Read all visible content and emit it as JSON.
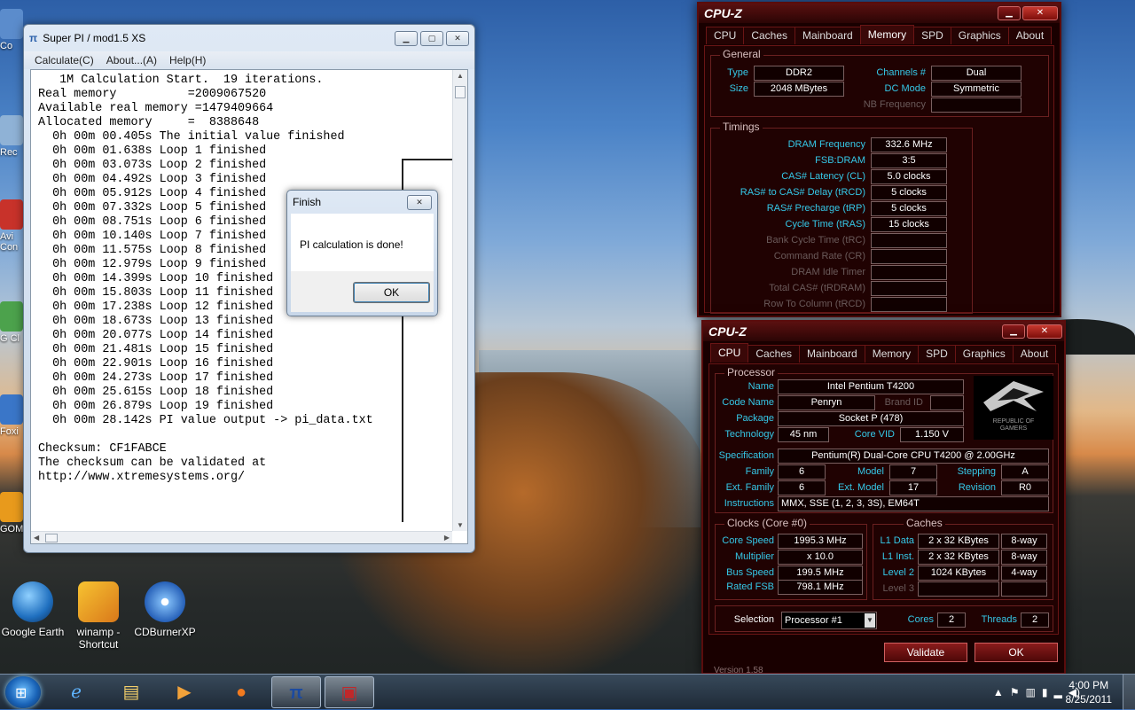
{
  "desktop": {
    "icons": [
      {
        "label": "Google Earth"
      },
      {
        "label": "winamp - Shortcut"
      },
      {
        "label": "CDBurnerXP"
      }
    ],
    "edge_icons": [
      "Co",
      "Rec",
      "Avi Con",
      "G Cl",
      "Foxi",
      "GOM"
    ]
  },
  "superpi": {
    "title": "Super PI / mod1.5 XS",
    "menu": [
      "Calculate(C)",
      "About...(A)",
      "Help(H)"
    ],
    "lines": [
      "   1M Calculation Start.  19 iterations.",
      "Real memory          =2009067520",
      "Available real memory =1479409664",
      "Allocated memory     =  8388648",
      "  0h 00m 00.405s The initial value finished",
      "  0h 00m 01.638s Loop 1 finished",
      "  0h 00m 03.073s Loop 2 finished",
      "  0h 00m 04.492s Loop 3 finished",
      "  0h 00m 05.912s Loop 4 finished",
      "  0h 00m 07.332s Loop 5 finished",
      "  0h 00m 08.751s Loop 6 finished",
      "  0h 00m 10.140s Loop 7 finished",
      "  0h 00m 11.575s Loop 8 finished",
      "  0h 00m 12.979s Loop 9 finished",
      "  0h 00m 14.399s Loop 10 finished",
      "  0h 00m 15.803s Loop 11 finished",
      "  0h 00m 17.238s Loop 12 finished",
      "  0h 00m 18.673s Loop 13 finished",
      "  0h 00m 20.077s Loop 14 finished",
      "  0h 00m 21.481s Loop 15 finished",
      "  0h 00m 22.901s Loop 16 finished",
      "  0h 00m 24.273s Loop 17 finished",
      "  0h 00m 25.615s Loop 18 finished",
      "  0h 00m 26.879s Loop 19 finished",
      "  0h 00m 28.142s PI value output -> pi_data.txt",
      "",
      "Checksum: CF1FABCE",
      "The checksum can be validated at",
      "http://www.xtremesystems.org/"
    ]
  },
  "finish_dialog": {
    "title": "Finish",
    "message": "PI calculation is done!",
    "ok": "OK"
  },
  "cpuz_memory": {
    "title": "CPU-Z",
    "tabs": [
      "CPU",
      "Caches",
      "Mainboard",
      "Memory",
      "SPD",
      "Graphics",
      "About"
    ],
    "active_tab": "Memory",
    "general_label": "General",
    "type_label": "Type",
    "type": "DDR2",
    "size_label": "Size",
    "size": "2048 MBytes",
    "channels_label": "Channels #",
    "channels": "Dual",
    "dcmode_label": "DC Mode",
    "dcmode": "Symmetric",
    "nbfreq_label": "NB Frequency",
    "nbfreq": "",
    "timings_label": "Timings",
    "timings": [
      {
        "label": "DRAM Frequency",
        "value": "332.6 MHz",
        "dim": false
      },
      {
        "label": "FSB:DRAM",
        "value": "3:5",
        "dim": false
      },
      {
        "label": "CAS# Latency (CL)",
        "value": "5.0 clocks",
        "dim": false
      },
      {
        "label": "RAS# to CAS# Delay (tRCD)",
        "value": "5 clocks",
        "dim": false
      },
      {
        "label": "RAS# Precharge (tRP)",
        "value": "5 clocks",
        "dim": false
      },
      {
        "label": "Cycle Time (tRAS)",
        "value": "15 clocks",
        "dim": false
      },
      {
        "label": "Bank Cycle Time (tRC)",
        "value": "",
        "dim": true
      },
      {
        "label": "Command Rate (CR)",
        "value": "",
        "dim": true
      },
      {
        "label": "DRAM Idle Timer",
        "value": "",
        "dim": true
      },
      {
        "label": "Total CAS# (tRDRAM)",
        "value": "",
        "dim": true
      },
      {
        "label": "Row To Column (tRCD)",
        "value": "",
        "dim": true
      }
    ]
  },
  "cpuz_cpu": {
    "title": "CPU-Z",
    "tabs": [
      "CPU",
      "Caches",
      "Mainboard",
      "Memory",
      "SPD",
      "Graphics",
      "About"
    ],
    "active_tab": "CPU",
    "processor_label": "Processor",
    "name_label": "Name",
    "name": "Intel Pentium T4200",
    "codename_label": "Code Name",
    "codename": "Penryn",
    "brandid_label": "Brand ID",
    "brandid": "",
    "package_label": "Package",
    "package": "Socket P (478)",
    "technology_label": "Technology",
    "technology": "45 nm",
    "corevid_label": "Core VID",
    "corevid": "1.150 V",
    "spec_label": "Specification",
    "spec": "Pentium(R) Dual-Core CPU     T4200  @ 2.00GHz",
    "family_label": "Family",
    "family": "6",
    "model_label": "Model",
    "model": "7",
    "stepping_label": "Stepping",
    "stepping": "A",
    "extfamily_label": "Ext. Family",
    "extfamily": "6",
    "extmodel_label": "Ext. Model",
    "extmodel": "17",
    "revision_label": "Revision",
    "revision": "R0",
    "instr_label": "Instructions",
    "instr": "MMX, SSE (1, 2, 3, 3S), EM64T",
    "clocks_label": "Clocks (Core #0)",
    "corespeed_label": "Core Speed",
    "corespeed": "1995.3 MHz",
    "multiplier_label": "Multiplier",
    "multiplier": "x 10.0",
    "busspeed_label": "Bus Speed",
    "busspeed": "199.5 MHz",
    "ratedfsb_label": "Rated FSB",
    "ratedfsb": "798.1 MHz",
    "caches_label": "Caches",
    "l1d_label": "L1 Data",
    "l1d": "2 x 32 KBytes",
    "l1d_way": "8-way",
    "l1i_label": "L1 Inst.",
    "l1i": "2 x 32 KBytes",
    "l1i_way": "8-way",
    "l2_label": "Level 2",
    "l2": "1024 KBytes",
    "l2_way": "4-way",
    "l3_label": "Level 3",
    "l3": "",
    "l3_way": "",
    "selection_label": "Selection",
    "selection": "Processor #1",
    "cores_label": "Cores",
    "cores": "2",
    "threads_label": "Threads",
    "threads": "2",
    "validate": "Validate",
    "ok": "OK",
    "version": "Version 1.58",
    "rog_text": "REPUBLIC OF GAMERS"
  },
  "taskbar": {
    "time": "4:00 PM",
    "date": "8/25/2011",
    "items": [
      "ie-icon",
      "folder-icon",
      "media-player-icon",
      "firefox-icon",
      "superpi-icon",
      "cpuz-icon"
    ]
  }
}
